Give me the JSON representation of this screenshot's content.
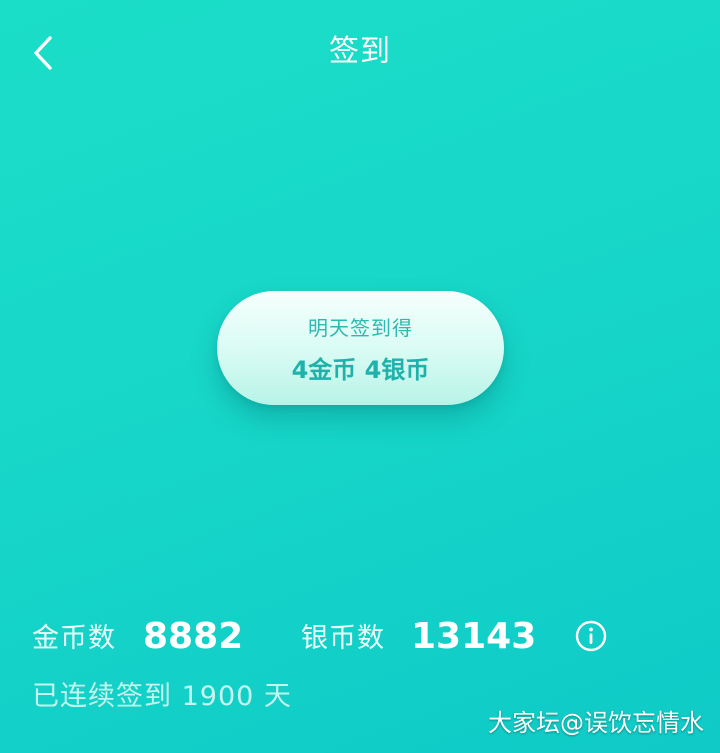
{
  "header": {
    "title": "签到",
    "back_icon": "chevron-left-icon"
  },
  "reward": {
    "caption": "明天签到得",
    "value": "4金币 4银币"
  },
  "stats": {
    "gold_label": "金币数",
    "gold_value": "8882",
    "silver_label": "银币数",
    "silver_value": "13143",
    "info_icon": "info-icon"
  },
  "streak_text": "已连续签到 1900 天",
  "watermark": "大家坛@误饮忘情水",
  "colors": {
    "background": "#17d7c9",
    "pill": "#d7fbf3",
    "accent_text": "#1fb2aa"
  }
}
